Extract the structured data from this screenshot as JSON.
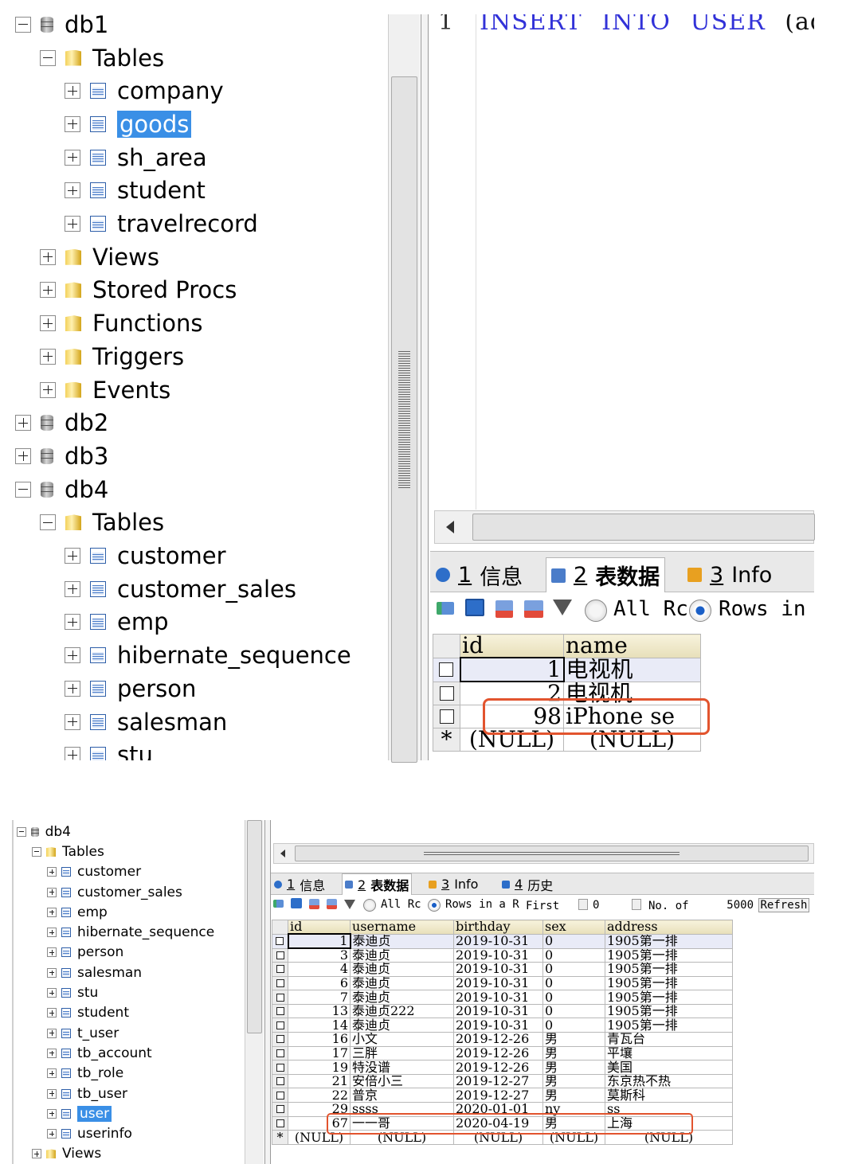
{
  "top": {
    "tree": [
      {
        "label": "db1",
        "type": "db",
        "level": 0,
        "toggle": "minus"
      },
      {
        "label": "Tables",
        "type": "folder",
        "level": 1,
        "toggle": "minus"
      },
      {
        "label": "company",
        "type": "table",
        "level": 2,
        "toggle": "plus"
      },
      {
        "label": "goods",
        "type": "table",
        "level": 2,
        "toggle": "plus",
        "selected": true
      },
      {
        "label": "sh_area",
        "type": "table",
        "level": 2,
        "toggle": "plus"
      },
      {
        "label": "student",
        "type": "table",
        "level": 2,
        "toggle": "plus"
      },
      {
        "label": "travelrecord",
        "type": "table",
        "level": 2,
        "toggle": "plus"
      },
      {
        "label": "Views",
        "type": "folder",
        "level": 1,
        "toggle": "plus"
      },
      {
        "label": "Stored Procs",
        "type": "folder",
        "level": 1,
        "toggle": "plus"
      },
      {
        "label": "Functions",
        "type": "folder",
        "level": 1,
        "toggle": "plus"
      },
      {
        "label": "Triggers",
        "type": "folder",
        "level": 1,
        "toggle": "plus"
      },
      {
        "label": "Events",
        "type": "folder",
        "level": 1,
        "toggle": "plus"
      },
      {
        "label": "db2",
        "type": "db",
        "level": 0,
        "toggle": "plus"
      },
      {
        "label": "db3",
        "type": "db",
        "level": 0,
        "toggle": "plus"
      },
      {
        "label": "db4",
        "type": "db",
        "level": 0,
        "toggle": "minus"
      },
      {
        "label": "Tables",
        "type": "folder",
        "level": 1,
        "toggle": "minus"
      },
      {
        "label": "customer",
        "type": "table",
        "level": 2,
        "toggle": "plus"
      },
      {
        "label": "customer_sales",
        "type": "table",
        "level": 2,
        "toggle": "plus"
      },
      {
        "label": "emp",
        "type": "table",
        "level": 2,
        "toggle": "plus"
      },
      {
        "label": "hibernate_sequence",
        "type": "table",
        "level": 2,
        "toggle": "plus"
      },
      {
        "label": "person",
        "type": "table",
        "level": 2,
        "toggle": "plus"
      },
      {
        "label": "salesman",
        "type": "table",
        "level": 2,
        "toggle": "plus"
      },
      {
        "label": "stu",
        "type": "table",
        "level": 2,
        "toggle": "plus"
      }
    ],
    "editor": {
      "line_no": "1",
      "keywords": [
        "INSERT",
        "INTO",
        "USER"
      ],
      "rest": "(addr"
    },
    "tabs": [
      {
        "num": "1",
        "label": "信息"
      },
      {
        "num": "2",
        "label": "表数据"
      },
      {
        "num": "3",
        "label": "Info"
      }
    ],
    "toolbar": {
      "all_label": "All Rc",
      "rows_label": "Rows in a"
    },
    "grid": {
      "columns": [
        "id",
        "name"
      ],
      "rows": [
        [
          "1",
          "电视机"
        ],
        [
          "2",
          "电视机"
        ],
        [
          "98",
          "iPhone se"
        ]
      ],
      "null_row": [
        "(NULL)",
        "(NULL)"
      ],
      "new_row_marker": "*"
    }
  },
  "bottom": {
    "tree": [
      {
        "label": "db4",
        "type": "db",
        "level": 0,
        "toggle": "minus"
      },
      {
        "label": "Tables",
        "type": "folder",
        "level": 1,
        "toggle": "minus"
      },
      {
        "label": "customer",
        "type": "table",
        "level": 2,
        "toggle": "plus"
      },
      {
        "label": "customer_sales",
        "type": "table",
        "level": 2,
        "toggle": "plus"
      },
      {
        "label": "emp",
        "type": "table",
        "level": 2,
        "toggle": "plus"
      },
      {
        "label": "hibernate_sequence",
        "type": "table",
        "level": 2,
        "toggle": "plus"
      },
      {
        "label": "person",
        "type": "table",
        "level": 2,
        "toggle": "plus"
      },
      {
        "label": "salesman",
        "type": "table",
        "level": 2,
        "toggle": "plus"
      },
      {
        "label": "stu",
        "type": "table",
        "level": 2,
        "toggle": "plus"
      },
      {
        "label": "student",
        "type": "table",
        "level": 2,
        "toggle": "plus"
      },
      {
        "label": "t_user",
        "type": "table",
        "level": 2,
        "toggle": "plus"
      },
      {
        "label": "tb_account",
        "type": "table",
        "level": 2,
        "toggle": "plus"
      },
      {
        "label": "tb_role",
        "type": "table",
        "level": 2,
        "toggle": "plus"
      },
      {
        "label": "tb_user",
        "type": "table",
        "level": 2,
        "toggle": "plus"
      },
      {
        "label": "user",
        "type": "table",
        "level": 2,
        "toggle": "plus",
        "selected": true
      },
      {
        "label": "userinfo",
        "type": "table",
        "level": 2,
        "toggle": "plus"
      },
      {
        "label": "Views",
        "type": "folder",
        "level": 1,
        "toggle": "plus"
      }
    ],
    "tabs": [
      {
        "num": "1",
        "label": "信息"
      },
      {
        "num": "2",
        "label": "表数据"
      },
      {
        "num": "3",
        "label": "Info"
      },
      {
        "num": "4",
        "label": "历史"
      }
    ],
    "toolbar": {
      "all_label": "All Rc",
      "rows_label": "Rows in a R",
      "first_label": "First",
      "first_value": "0",
      "no_of_label": "No. of",
      "count_value": "5000",
      "refresh_label": "Refresh"
    },
    "grid": {
      "columns": [
        "id",
        "username",
        "birthday",
        "sex",
        "address"
      ],
      "rows": [
        [
          "1",
          "泰迪贞",
          "2019-10-31",
          "0",
          "1905第一排"
        ],
        [
          "3",
          "泰迪贞",
          "2019-10-31",
          "0",
          "1905第一排"
        ],
        [
          "4",
          "泰迪贞",
          "2019-10-31",
          "0",
          "1905第一排"
        ],
        [
          "6",
          "泰迪贞",
          "2019-10-31",
          "0",
          "1905第一排"
        ],
        [
          "7",
          "泰迪贞",
          "2019-10-31",
          "0",
          "1905第一排"
        ],
        [
          "13",
          "泰迪贞222",
          "2019-10-31",
          "0",
          "1905第一排"
        ],
        [
          "14",
          "泰迪贞",
          "2019-10-31",
          "0",
          "1905第一排"
        ],
        [
          "16",
          "小文",
          "2019-12-26",
          "男",
          "青瓦台"
        ],
        [
          "17",
          "三胖",
          "2019-12-26",
          "男",
          "平壤"
        ],
        [
          "19",
          "特没谱",
          "2019-12-26",
          "男",
          "美国"
        ],
        [
          "21",
          "安倍小三",
          "2019-12-27",
          "男",
          "东京热不热"
        ],
        [
          "22",
          "普京",
          "2019-12-27",
          "男",
          "莫斯科"
        ],
        [
          "29",
          "ssss",
          "2020-01-01",
          "ny",
          "ss"
        ],
        [
          "67",
          "一一哥",
          "2020-04-19",
          "男",
          "上海"
        ]
      ],
      "null_row": [
        "(NULL)",
        "(NULL)",
        "(NULL)",
        "(NULL)",
        "(NULL)"
      ],
      "new_row_marker": "*"
    }
  }
}
